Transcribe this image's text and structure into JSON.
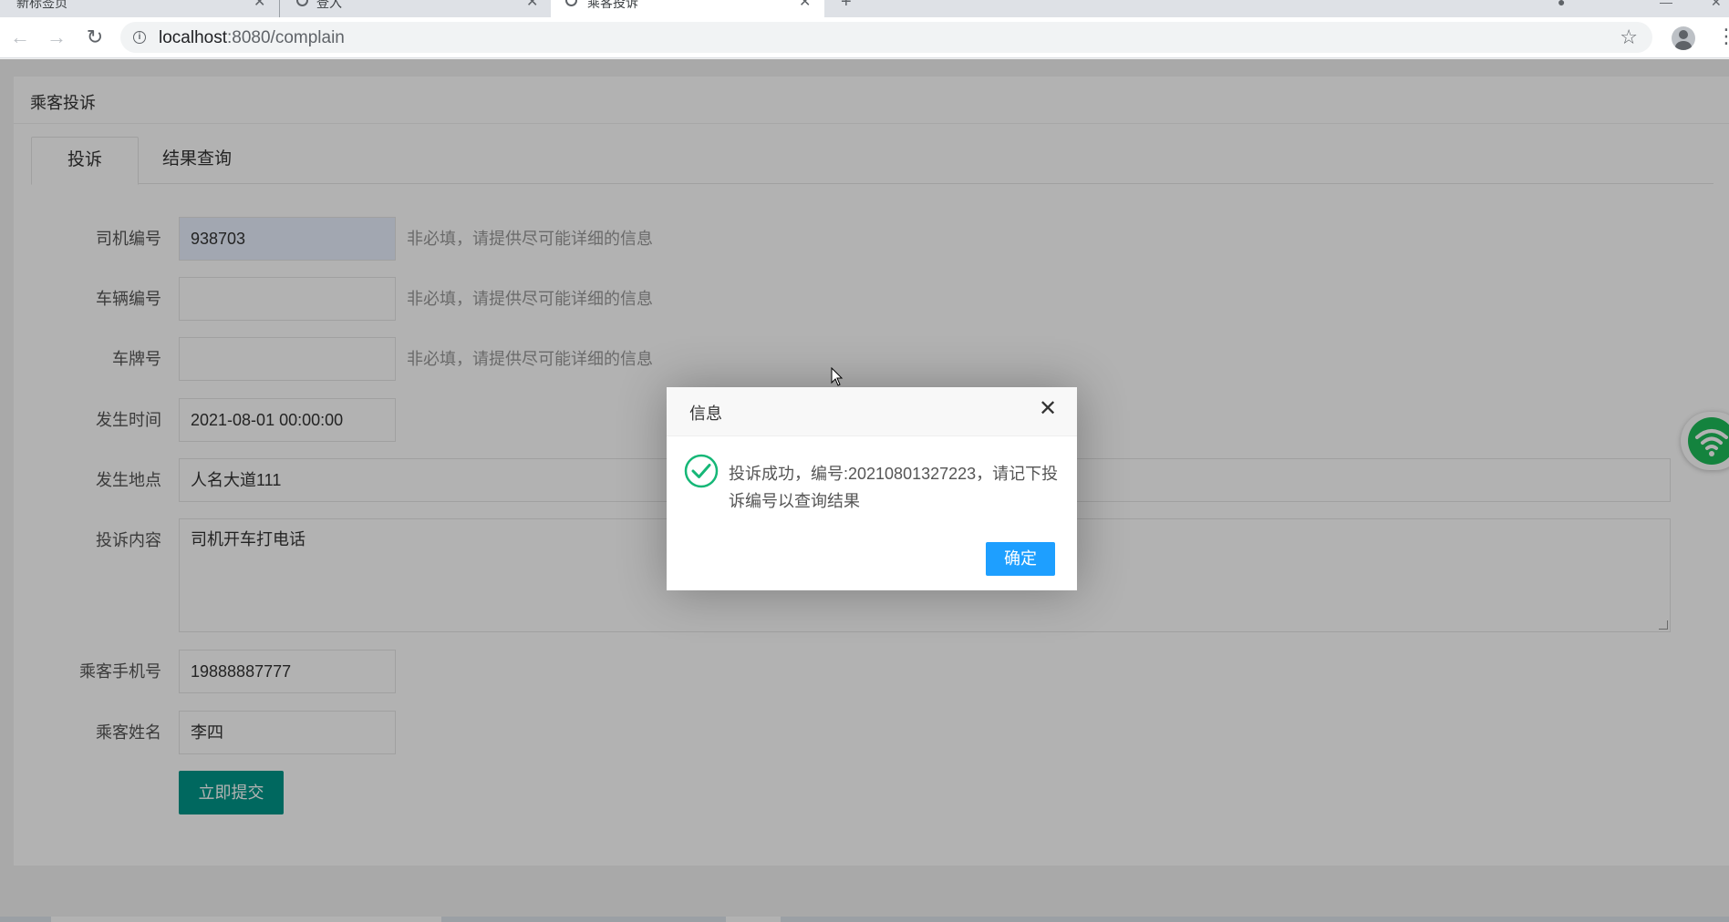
{
  "browser": {
    "tabs": [
      {
        "label": "新标签页"
      },
      {
        "label": "登入"
      },
      {
        "label": "乘客投诉"
      }
    ],
    "url_host": "localhost",
    "url_path": ":8080/complain"
  },
  "page": {
    "title": "乘客投诉",
    "tabs": [
      {
        "label": "投诉"
      },
      {
        "label": "结果查询"
      }
    ],
    "form": {
      "driver_id": {
        "label": "司机编号",
        "value": "938703",
        "hint": "非必填，请提供尽可能详细的信息"
      },
      "vehicle_id": {
        "label": "车辆编号",
        "value": "",
        "hint": "非必填，请提供尽可能详细的信息"
      },
      "plate": {
        "label": "车牌号",
        "value": "",
        "hint": "非必填，请提供尽可能详细的信息"
      },
      "time": {
        "label": "发生时间",
        "value": "2021-08-01 00:00:00"
      },
      "location": {
        "label": "发生地点",
        "value": "人名大道111"
      },
      "content": {
        "label": "投诉内容",
        "value": "司机开车打电话"
      },
      "phone": {
        "label": "乘客手机号",
        "value": "19888887777"
      },
      "name": {
        "label": "乘客姓名",
        "value": "李四"
      },
      "submit_label": "立即提交"
    }
  },
  "dialog": {
    "title": "信息",
    "message": "投诉成功，编号:20210801327223，请记下投诉编号以查询结果",
    "ok_label": "确定",
    "icon": "success-check-icon",
    "close_icon": "close-icon"
  },
  "colors": {
    "primary_green": "#009688",
    "dialog_blue": "#1e9fff",
    "success_teal": "#16b777",
    "wifi_green": "#1ebc5a"
  }
}
